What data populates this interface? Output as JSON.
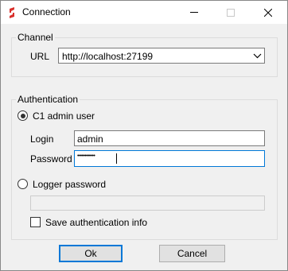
{
  "window": {
    "title": "Connection"
  },
  "channel": {
    "group_label": "Channel",
    "url_label": "URL",
    "url_value": "http://localhost:27199"
  },
  "authentication": {
    "group_label": "Authentication",
    "c1_admin_label": "C1 admin user",
    "c1_admin_selected": true,
    "login_label": "Login",
    "login_value": "admin",
    "password_label": "Password",
    "password_masked": "••••••••••••",
    "logger_password_label": "Logger password",
    "logger_password_selected": false,
    "logger_password_value": "",
    "save_auth_label": "Save authentication info",
    "save_auth_checked": false
  },
  "buttons": {
    "ok_label": "Ok",
    "cancel_label": "Cancel"
  },
  "colors": {
    "focus_border": "#0078d7",
    "window_bg": "#f0f0f0"
  }
}
